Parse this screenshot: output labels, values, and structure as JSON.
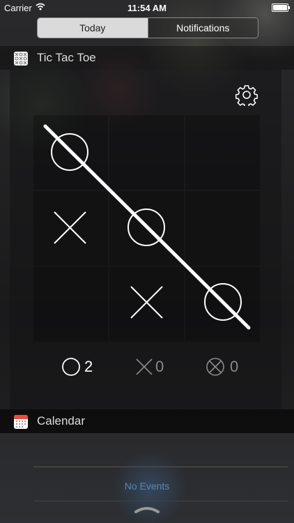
{
  "status_bar": {
    "carrier": "Carrier",
    "time": "11:54 AM",
    "battery_level": 1.0
  },
  "segmented_control": {
    "tabs": [
      "Today",
      "Notifications"
    ],
    "selected": "Today"
  },
  "tic_tac_toe": {
    "title": "Tic Tac Toe",
    "board": [
      [
        "O",
        "",
        ""
      ],
      [
        "X",
        "O",
        ""
      ],
      [
        "",
        "X",
        "O"
      ]
    ],
    "winning_line": "diagonal-top-left-to-bottom-right",
    "scores": {
      "o_wins": "2",
      "x_wins": "0",
      "draws": "0"
    }
  },
  "calendar": {
    "title": "Calendar",
    "empty_message": "No Events"
  },
  "colors": {
    "accent_blue": "#5b86b0",
    "segment_active": "#dadada",
    "dim_text": "#8a8a8a"
  },
  "icons": [
    "wifi-icon",
    "battery-icon",
    "tictactoe-app-icon",
    "gear-icon",
    "circle-mark-icon",
    "x-mark-icon",
    "draw-icon",
    "calendar-app-icon",
    "grabber-icon"
  ]
}
